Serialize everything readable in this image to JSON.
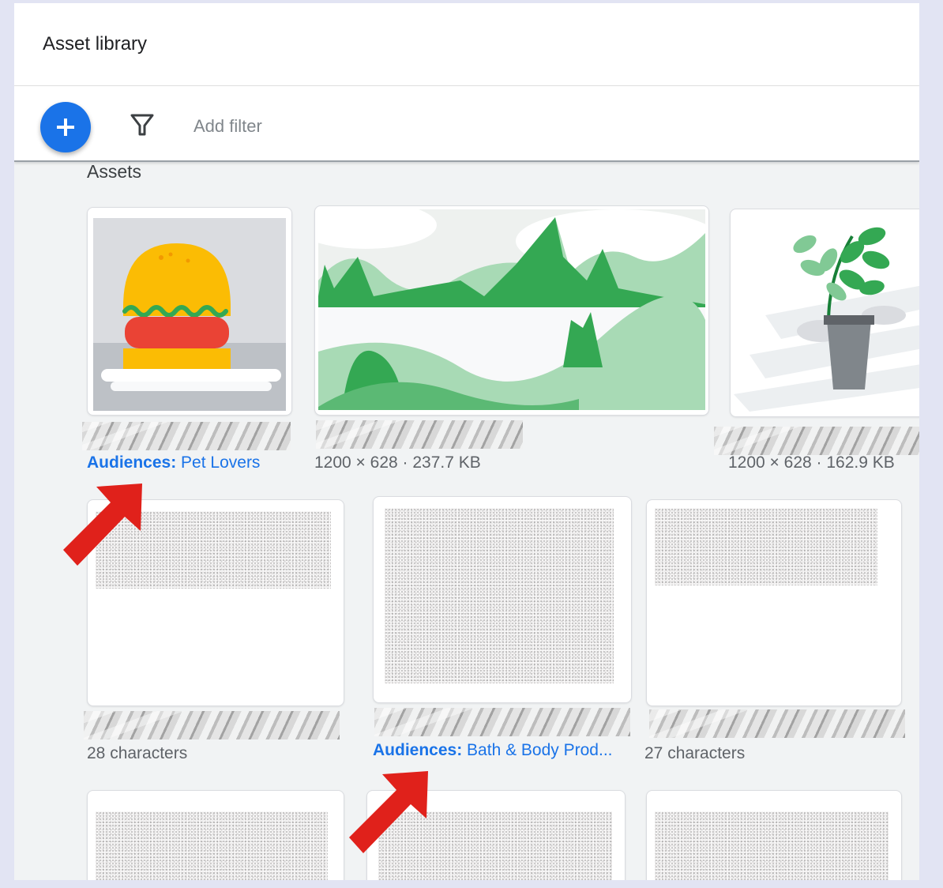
{
  "header": {
    "title": "Asset library"
  },
  "toolbar": {
    "add_icon": "plus-icon",
    "filter_icon": "filter-funnel-icon",
    "filter_placeholder": "Add filter"
  },
  "section": {
    "title": "Assets"
  },
  "assets": [
    {
      "kind": "image",
      "subject": "burger",
      "audience_label": "Audiences:",
      "audience_value": "Pet Lovers"
    },
    {
      "kind": "image",
      "subject": "landscape",
      "meta": "1200 × 628 · 237.7 KB"
    },
    {
      "kind": "image",
      "subject": "plant",
      "meta": "1200 × 628 · 162.9 KB"
    },
    {
      "kind": "text",
      "meta": "28 characters"
    },
    {
      "kind": "text",
      "audience_label": "Audiences:",
      "audience_value": "Bath & Body Prod..."
    },
    {
      "kind": "text",
      "meta": "27 characters"
    }
  ],
  "colors": {
    "accent": "#1a73e8",
    "annotation_arrow": "#e0211b"
  }
}
